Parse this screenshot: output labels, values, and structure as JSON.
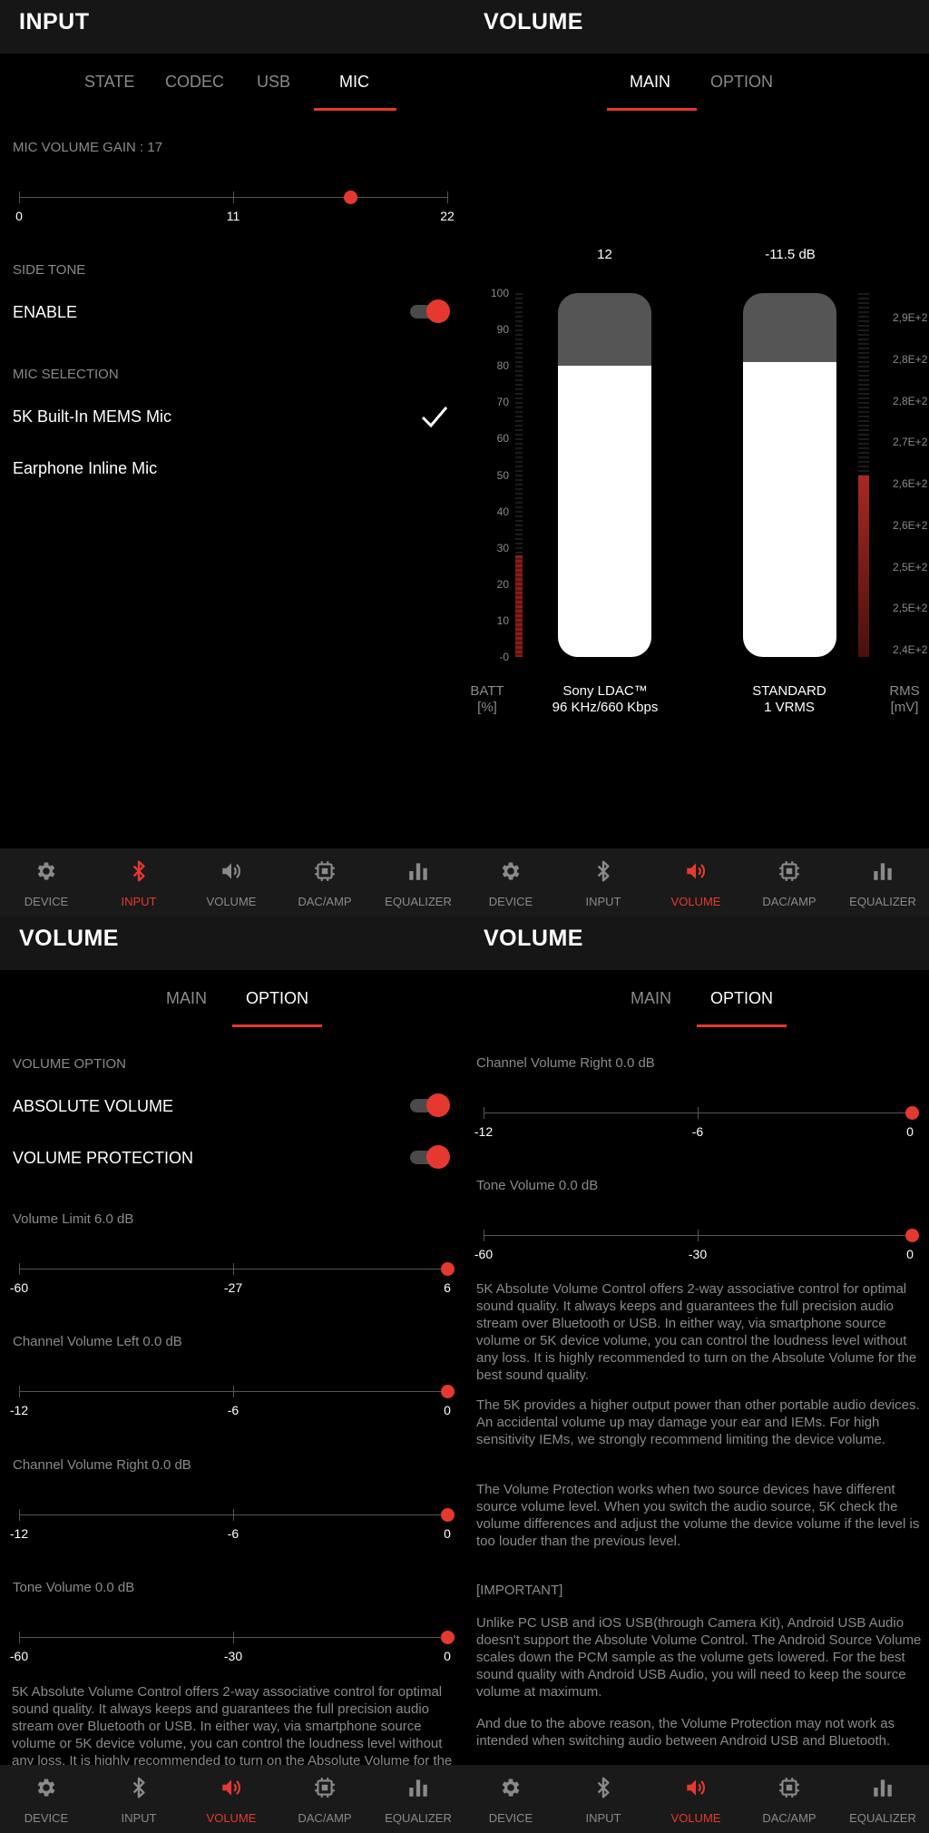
{
  "nav": {
    "device": "DEVICE",
    "input": "INPUT",
    "volume": "VOLUME",
    "dacamp": "DAC/AMP",
    "equalizer": "EQUALIZER"
  },
  "input_panel": {
    "title": "INPUT",
    "tabs": [
      "STATE",
      "CODEC",
      "USB",
      "MIC"
    ],
    "active_tab": "MIC",
    "mic_gain_label": "MIC VOLUME GAIN : 17",
    "mic_gain_value": 17,
    "mic_gain_min": 0,
    "mic_gain_max": 22,
    "mic_gain_ticks": [
      "0",
      "11",
      "22"
    ],
    "side_tone_header": "SIDE TONE",
    "enable_label": "ENABLE",
    "enable_on": true,
    "mic_selection_header": "MIC SELECTION",
    "mic_options": [
      "5K Built-In MEMS Mic",
      "Earphone Inline Mic"
    ],
    "selected_mic": "5K Built-In MEMS Mic"
  },
  "volume_main_panel": {
    "title": "VOLUME",
    "tabs": [
      "MAIN",
      "OPTION"
    ],
    "active_tab": "MAIN",
    "left_value": "12",
    "right_value": "-11.5 dB",
    "left_fill_fraction": 0.8,
    "right_fill_fraction": 0.81,
    "batt_level_percent": 28,
    "rms_level_fraction": 0.5,
    "batt_scale": [
      "100",
      "90",
      "80",
      "70",
      "60",
      "50",
      "40",
      "30",
      "20",
      "10",
      "-0"
    ],
    "rms_scale": [
      "2,9E+2",
      "2,8E+2",
      "2,8E+2",
      "2,7E+2",
      "2,6E+2",
      "2,6E+2",
      "2,5E+2",
      "2,5E+2",
      "2,4E+2"
    ],
    "batt_label": "BATT",
    "batt_unit": "[%]",
    "codec_line1": "Sony LDAC™",
    "codec_line2": "96 KHz/660 Kbps",
    "output_line1": "STANDARD",
    "output_line2": "1 VRMS",
    "rms_label": "RMS",
    "rms_unit": "[mV]"
  },
  "volume_option_panel": {
    "title": "VOLUME",
    "tabs": [
      "MAIN",
      "OPTION"
    ],
    "active_tab": "OPTION",
    "volume_option_header": "VOLUME OPTION",
    "absolute_volume_label": "ABSOLUTE VOLUME",
    "absolute_volume_on": true,
    "volume_protection_label": "VOLUME PROTECTION",
    "volume_protection_on": true,
    "volume_limit_label": "Volume Limit 6.0 dB",
    "volume_limit_ticks": [
      "-60",
      "-27",
      "6"
    ],
    "volume_limit_value": 6,
    "channel_left_label": "Channel Volume Left 0.0 dB",
    "channel_left_ticks": [
      "-12",
      "-6",
      "0"
    ],
    "channel_left_value": 0,
    "channel_right_label": "Channel Volume Right 0.0 dB",
    "channel_right_ticks": [
      "-12",
      "-6",
      "0"
    ],
    "channel_right_value": 0,
    "tone_volume_label": "Tone Volume 0.0 dB",
    "tone_volume_ticks": [
      "-60",
      "-30",
      "0"
    ],
    "tone_volume_value": 0,
    "para_absolute": "5K Absolute Volume Control offers 2-way associative control for optimal sound quality. It always keeps and guarantees the full precision audio stream over Bluetooth or USB. In either way, via smartphone source volume or 5K device volume, you can control the loudness level without any loss. It is highly recommended to turn on the Absolute Volume for the best sound quality.",
    "para_power": "The 5K provides a higher output power than other portable audio devices. An accidental volume up may damage your ear and IEMs. For high sensitivity IEMs, we strongly recommend limiting the device volume.",
    "para_protection": "The Volume Protection works when two source devices have different source volume level. When you switch the audio source, 5K check the volume differences and adjust the volume the device volume if the level is too louder than the previous level.",
    "important_label": "[IMPORTANT]",
    "para_important": "Unlike PC USB and iOS USB(through Camera Kit), Android USB Audio doesn't support the Absolute Volume Control. The Android Source Volume scales down the PCM sample as the volume gets lowered. For the best sound quality with Android USB Audio, you will need to keep the source volume at maximum.",
    "para_reason": "And due to the above reason, the Volume Protection may not work as intended when switching audio between Android USB and Bluetooth."
  },
  "colors": {
    "accent": "#e5392f",
    "appbar": "#161616",
    "navbar": "#1a1a1a",
    "muted_text": "#8a8a8a"
  }
}
